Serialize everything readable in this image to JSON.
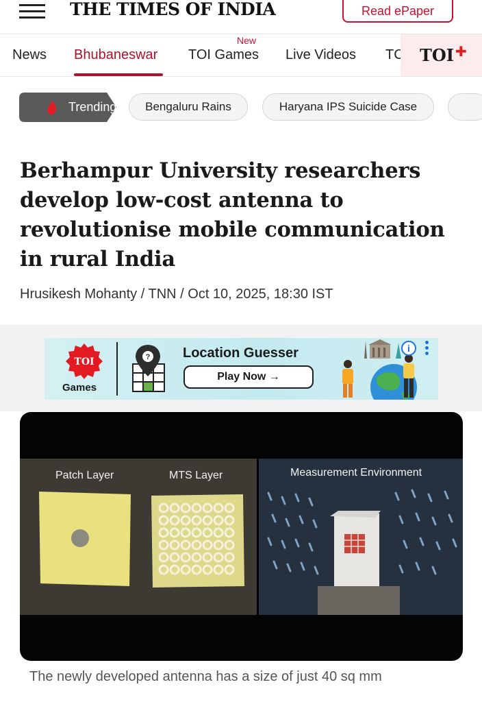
{
  "header": {
    "masthead": "THE TIMES OF INDIA",
    "epaper_label": "Read ePaper"
  },
  "nav": {
    "items": [
      {
        "label": "News"
      },
      {
        "label": "Bhubaneswar",
        "active": true
      },
      {
        "label": "TOI Games",
        "badge": "New"
      },
      {
        "label": "Live Videos"
      },
      {
        "label": "TC"
      }
    ],
    "toi_plus": "TOI",
    "accent_color": "#b0102a"
  },
  "trending": {
    "label": "Trending",
    "chips": [
      "Bengaluru Rains",
      "Haryana IPS Suicide Case"
    ]
  },
  "article": {
    "headline": "Berhampur University researchers develop low-cost antenna to revolutionise mobile communication in rural India",
    "byline": "Hrusikesh Mohanty / TNN / Oct 10, 2025, 18:30 IST",
    "image_caption": "The newly developed antenna has a size of just 40 sq mm"
  },
  "ad": {
    "brand": "TOI",
    "brand_sub": "Games",
    "title": "Location Guesser",
    "button": "Play Now →",
    "info_icon": "i"
  },
  "photo": {
    "labels": {
      "patch": "Patch Layer",
      "mts": "MTS Layer",
      "measurement": "Measurement Environment"
    }
  }
}
